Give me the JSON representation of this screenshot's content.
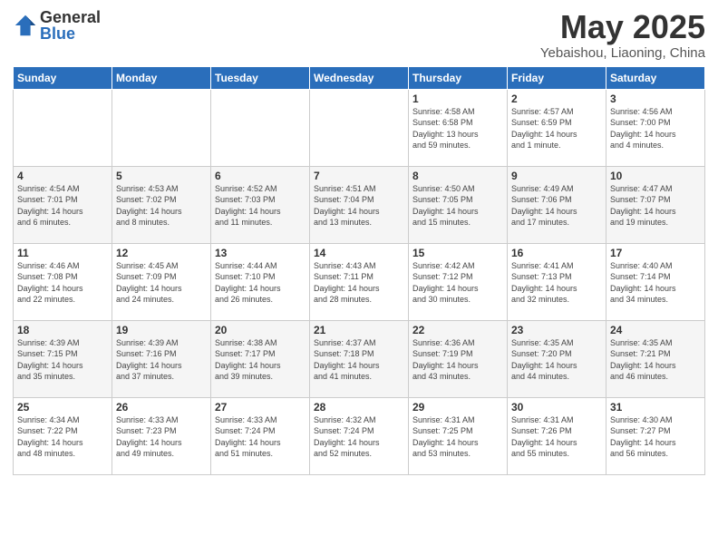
{
  "logo": {
    "general": "General",
    "blue": "Blue"
  },
  "header": {
    "month": "May 2025",
    "location": "Yebaishou, Liaoning, China"
  },
  "weekdays": [
    "Sunday",
    "Monday",
    "Tuesday",
    "Wednesday",
    "Thursday",
    "Friday",
    "Saturday"
  ],
  "weeks": [
    [
      {
        "day": "",
        "info": ""
      },
      {
        "day": "",
        "info": ""
      },
      {
        "day": "",
        "info": ""
      },
      {
        "day": "",
        "info": ""
      },
      {
        "day": "1",
        "info": "Sunrise: 4:58 AM\nSunset: 6:58 PM\nDaylight: 13 hours\nand 59 minutes."
      },
      {
        "day": "2",
        "info": "Sunrise: 4:57 AM\nSunset: 6:59 PM\nDaylight: 14 hours\nand 1 minute."
      },
      {
        "day": "3",
        "info": "Sunrise: 4:56 AM\nSunset: 7:00 PM\nDaylight: 14 hours\nand 4 minutes."
      }
    ],
    [
      {
        "day": "4",
        "info": "Sunrise: 4:54 AM\nSunset: 7:01 PM\nDaylight: 14 hours\nand 6 minutes."
      },
      {
        "day": "5",
        "info": "Sunrise: 4:53 AM\nSunset: 7:02 PM\nDaylight: 14 hours\nand 8 minutes."
      },
      {
        "day": "6",
        "info": "Sunrise: 4:52 AM\nSunset: 7:03 PM\nDaylight: 14 hours\nand 11 minutes."
      },
      {
        "day": "7",
        "info": "Sunrise: 4:51 AM\nSunset: 7:04 PM\nDaylight: 14 hours\nand 13 minutes."
      },
      {
        "day": "8",
        "info": "Sunrise: 4:50 AM\nSunset: 7:05 PM\nDaylight: 14 hours\nand 15 minutes."
      },
      {
        "day": "9",
        "info": "Sunrise: 4:49 AM\nSunset: 7:06 PM\nDaylight: 14 hours\nand 17 minutes."
      },
      {
        "day": "10",
        "info": "Sunrise: 4:47 AM\nSunset: 7:07 PM\nDaylight: 14 hours\nand 19 minutes."
      }
    ],
    [
      {
        "day": "11",
        "info": "Sunrise: 4:46 AM\nSunset: 7:08 PM\nDaylight: 14 hours\nand 22 minutes."
      },
      {
        "day": "12",
        "info": "Sunrise: 4:45 AM\nSunset: 7:09 PM\nDaylight: 14 hours\nand 24 minutes."
      },
      {
        "day": "13",
        "info": "Sunrise: 4:44 AM\nSunset: 7:10 PM\nDaylight: 14 hours\nand 26 minutes."
      },
      {
        "day": "14",
        "info": "Sunrise: 4:43 AM\nSunset: 7:11 PM\nDaylight: 14 hours\nand 28 minutes."
      },
      {
        "day": "15",
        "info": "Sunrise: 4:42 AM\nSunset: 7:12 PM\nDaylight: 14 hours\nand 30 minutes."
      },
      {
        "day": "16",
        "info": "Sunrise: 4:41 AM\nSunset: 7:13 PM\nDaylight: 14 hours\nand 32 minutes."
      },
      {
        "day": "17",
        "info": "Sunrise: 4:40 AM\nSunset: 7:14 PM\nDaylight: 14 hours\nand 34 minutes."
      }
    ],
    [
      {
        "day": "18",
        "info": "Sunrise: 4:39 AM\nSunset: 7:15 PM\nDaylight: 14 hours\nand 35 minutes."
      },
      {
        "day": "19",
        "info": "Sunrise: 4:39 AM\nSunset: 7:16 PM\nDaylight: 14 hours\nand 37 minutes."
      },
      {
        "day": "20",
        "info": "Sunrise: 4:38 AM\nSunset: 7:17 PM\nDaylight: 14 hours\nand 39 minutes."
      },
      {
        "day": "21",
        "info": "Sunrise: 4:37 AM\nSunset: 7:18 PM\nDaylight: 14 hours\nand 41 minutes."
      },
      {
        "day": "22",
        "info": "Sunrise: 4:36 AM\nSunset: 7:19 PM\nDaylight: 14 hours\nand 43 minutes."
      },
      {
        "day": "23",
        "info": "Sunrise: 4:35 AM\nSunset: 7:20 PM\nDaylight: 14 hours\nand 44 minutes."
      },
      {
        "day": "24",
        "info": "Sunrise: 4:35 AM\nSunset: 7:21 PM\nDaylight: 14 hours\nand 46 minutes."
      }
    ],
    [
      {
        "day": "25",
        "info": "Sunrise: 4:34 AM\nSunset: 7:22 PM\nDaylight: 14 hours\nand 48 minutes."
      },
      {
        "day": "26",
        "info": "Sunrise: 4:33 AM\nSunset: 7:23 PM\nDaylight: 14 hours\nand 49 minutes."
      },
      {
        "day": "27",
        "info": "Sunrise: 4:33 AM\nSunset: 7:24 PM\nDaylight: 14 hours\nand 51 minutes."
      },
      {
        "day": "28",
        "info": "Sunrise: 4:32 AM\nSunset: 7:24 PM\nDaylight: 14 hours\nand 52 minutes."
      },
      {
        "day": "29",
        "info": "Sunrise: 4:31 AM\nSunset: 7:25 PM\nDaylight: 14 hours\nand 53 minutes."
      },
      {
        "day": "30",
        "info": "Sunrise: 4:31 AM\nSunset: 7:26 PM\nDaylight: 14 hours\nand 55 minutes."
      },
      {
        "day": "31",
        "info": "Sunrise: 4:30 AM\nSunset: 7:27 PM\nDaylight: 14 hours\nand 56 minutes."
      }
    ]
  ]
}
